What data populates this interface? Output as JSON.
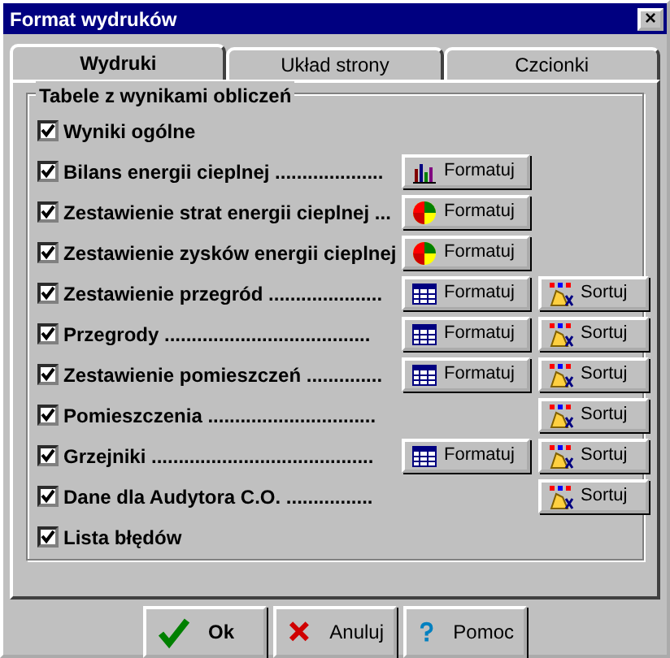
{
  "window": {
    "title": "Format wydruków",
    "close": "×"
  },
  "tabs": [
    {
      "label": "Wydruki",
      "selected": true
    },
    {
      "label": "Układ strony",
      "selected": false
    },
    {
      "label": "Czcionki",
      "selected": false
    }
  ],
  "group": {
    "title": "Tabele z wynikami obliczeń",
    "rows": [
      {
        "label": "Wyniki ogólne",
        "checked": true
      },
      {
        "label": "Bilans energii cieplnej ....................",
        "checked": true,
        "format": {
          "label": "Formatuj",
          "kind": "bars"
        }
      },
      {
        "label": "Zestawienie strat energii cieplnej ...",
        "checked": true,
        "format": {
          "label": "Formatuj",
          "kind": "pie"
        }
      },
      {
        "label": "Zestawienie zysków energii cieplnej",
        "checked": true,
        "format": {
          "label": "Formatuj",
          "kind": "pie"
        }
      },
      {
        "label": "Zestawienie przegród .....................",
        "checked": true,
        "format": {
          "label": "Formatuj",
          "kind": "table"
        },
        "sort": {
          "label": "Sortuj"
        }
      },
      {
        "label": "Przegrody ......................................",
        "checked": true,
        "format": {
          "label": "Formatuj",
          "kind": "table"
        },
        "sort": {
          "label": "Sortuj"
        }
      },
      {
        "label": "Zestawienie pomieszczeń ..............",
        "checked": true,
        "format": {
          "label": "Formatuj",
          "kind": "table"
        },
        "sort": {
          "label": "Sortuj"
        }
      },
      {
        "label": "Pomieszczenia ...............................",
        "checked": true,
        "sort": {
          "label": "Sortuj"
        }
      },
      {
        "label": "Grzejniki .........................................",
        "checked": true,
        "format": {
          "label": "Formatuj",
          "kind": "table"
        },
        "sort": {
          "label": "Sortuj"
        }
      },
      {
        "label": "Dane dla Audytora C.O. ................",
        "checked": true,
        "sort": {
          "label": "Sortuj"
        }
      },
      {
        "label": "Lista błędów",
        "checked": true
      }
    ]
  },
  "buttons": [
    {
      "label": "Ok",
      "kind": "ok"
    },
    {
      "label": "Anuluj",
      "kind": "cancel"
    },
    {
      "label": "Pomoc",
      "kind": "help"
    }
  ]
}
